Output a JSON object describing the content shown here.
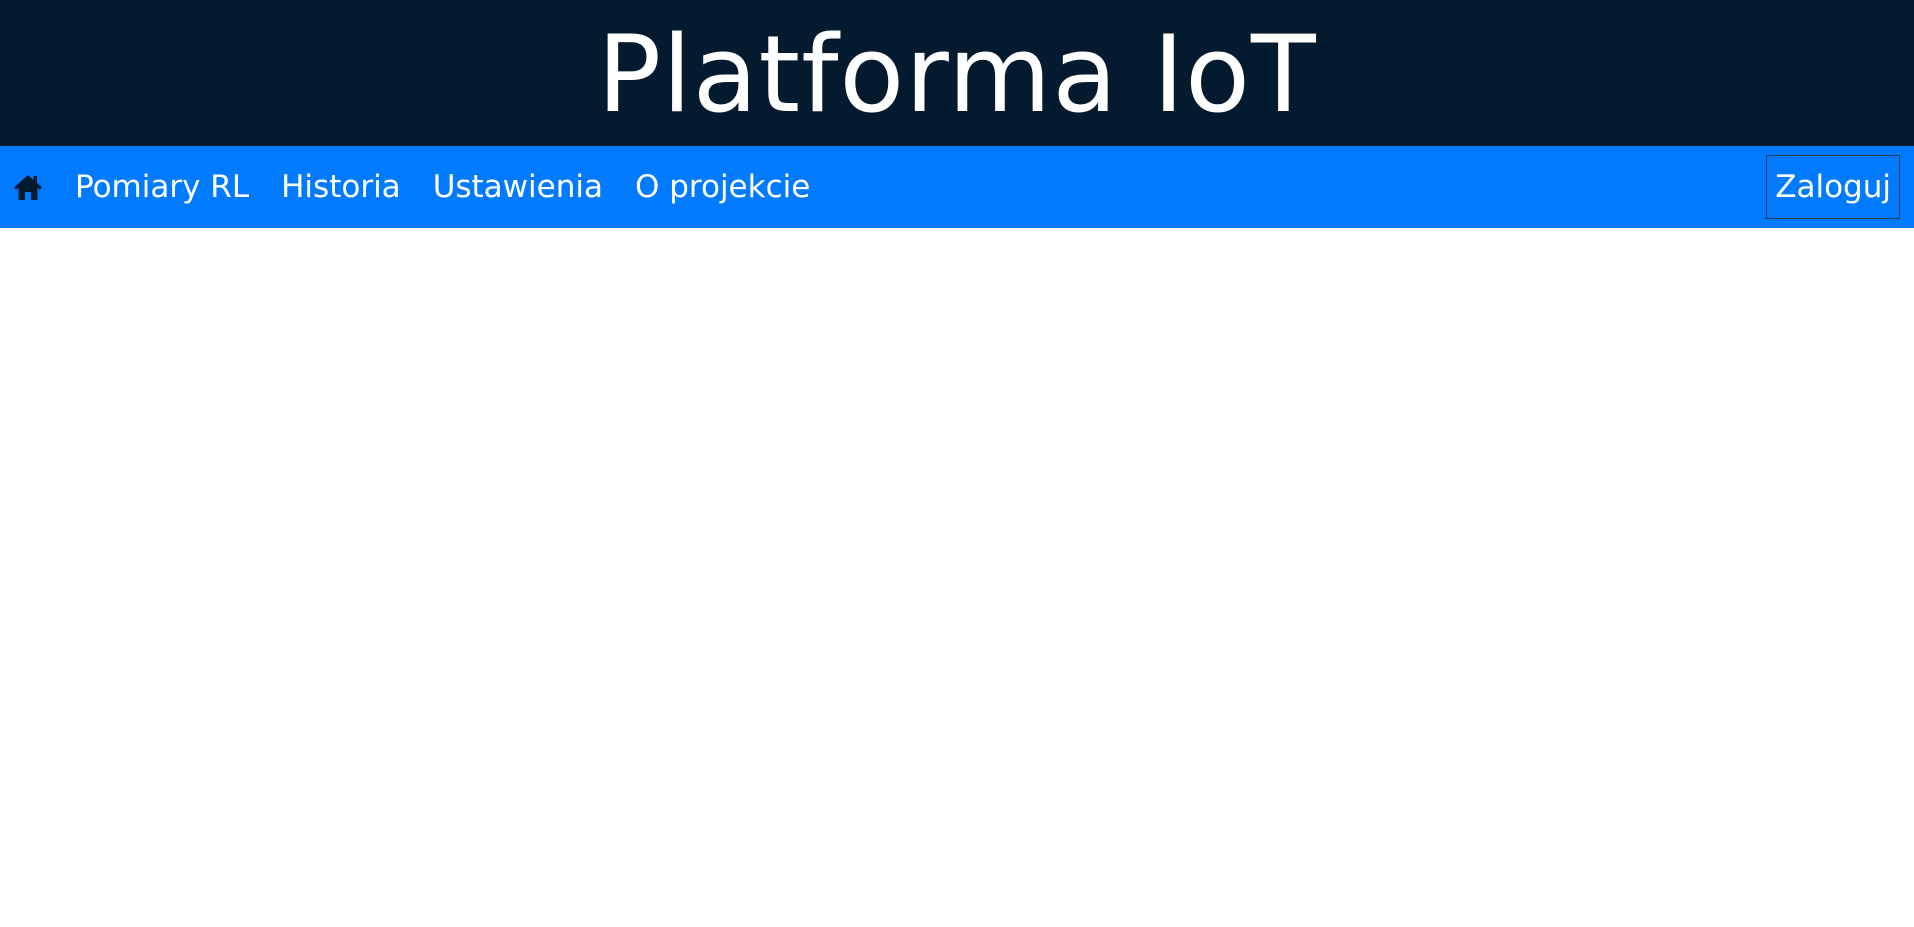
{
  "header": {
    "title": "Platforma IoT",
    "background": "#041a2e"
  },
  "navbar": {
    "background": "#007bff",
    "home_icon": "home-icon",
    "items": [
      {
        "label": "Pomiary RL"
      },
      {
        "label": "Historia"
      },
      {
        "label": "Ustawienia"
      },
      {
        "label": "O projekcie"
      }
    ],
    "login_label": "Zaloguj"
  }
}
